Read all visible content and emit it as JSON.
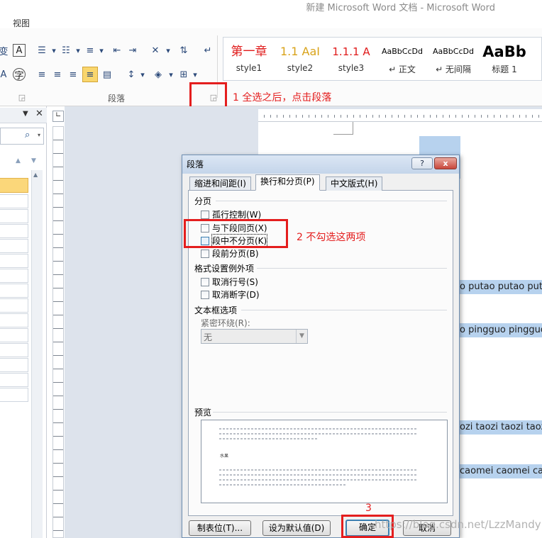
{
  "window": {
    "title": "新建 Microsoft Word 文档  -  Microsoft Word"
  },
  "menu": {
    "view": "视图"
  },
  "ribbon": {
    "group_paragraph": "段落",
    "styles": [
      {
        "preview": "第一章",
        "name": "style1",
        "color": "#e01b1b"
      },
      {
        "preview": "1.1 AaI",
        "name": "style2",
        "color": "#d9a31a"
      },
      {
        "preview": "1.1.1 A",
        "name": "style3",
        "color": "#e01b1b"
      },
      {
        "preview": "AaBbCcDd",
        "name": "↵ 正文",
        "color": "#000000"
      },
      {
        "preview": "AaBbCcDd",
        "name": "↵ 无间隔",
        "color": "#000000"
      },
      {
        "preview": "AaBb",
        "name": "标题 1",
        "color": "#000000"
      }
    ]
  },
  "annotations": {
    "step1": "1  全选之后，点击段落",
    "step2": "2  不勾选这两项",
    "step3": "3"
  },
  "document": {
    "lines": [
      "o putao putao puta",
      "o pingguo pingguo",
      "ozi taozi taozi taozi",
      "caomei caomei cao"
    ]
  },
  "dialog": {
    "title": "段落",
    "help": "?",
    "close": "x",
    "tabs": [
      "缩进和间距(I)",
      "换行和分页(P)",
      "中文版式(H)"
    ],
    "active_tab": "换行和分页(P)",
    "pagination": {
      "label": "分页",
      "options": [
        {
          "label": "孤行控制(W)",
          "checked": false
        },
        {
          "label": "与下段同页(X)",
          "checked": false
        },
        {
          "label": "段中不分页(K)",
          "checked": false
        },
        {
          "label": "段前分页(B)",
          "checked": false
        }
      ]
    },
    "formatting_exceptions": {
      "label": "格式设置例外项",
      "options": [
        {
          "label": "取消行号(S)",
          "checked": false
        },
        {
          "label": "取消断字(D)",
          "checked": false
        }
      ]
    },
    "textbox": {
      "label": "文本框选项",
      "tight_wrap_label": "紧密环绕(R):",
      "tight_wrap_value": "无"
    },
    "preview": {
      "label": "预览",
      "sample": "水果"
    },
    "buttons": {
      "tabs": "制表位(T)...",
      "set_default": "设为默认值(D)",
      "ok": "确定",
      "cancel": "取消"
    }
  },
  "watermark": "https://blog.csdn.net/LzzMandy"
}
